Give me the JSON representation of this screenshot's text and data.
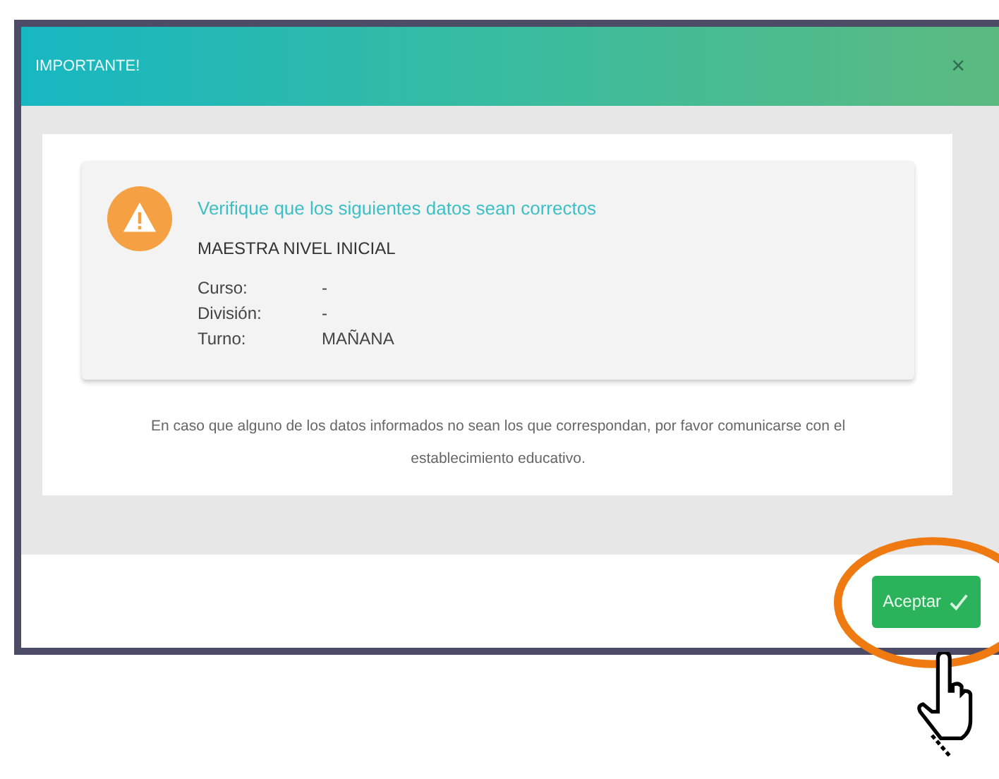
{
  "dialog": {
    "title": "IMPORTANTE!",
    "close": "×"
  },
  "notice": {
    "heading": "Verifique que los siguientes datos sean correctos",
    "role": "MAESTRA NIVEL INICIAL",
    "fields": [
      {
        "label": "Curso:",
        "value": "-"
      },
      {
        "label": "División:",
        "value": "-"
      },
      {
        "label": "Turno:",
        "value": "MAÑANA"
      }
    ]
  },
  "note": "En caso que alguno de los datos informados no sean los que correspondan, por favor comunicarse con el establecimiento educativo.",
  "buttons": [
    {
      "label": "Aceptar",
      "highlighted": true
    }
  ]
}
